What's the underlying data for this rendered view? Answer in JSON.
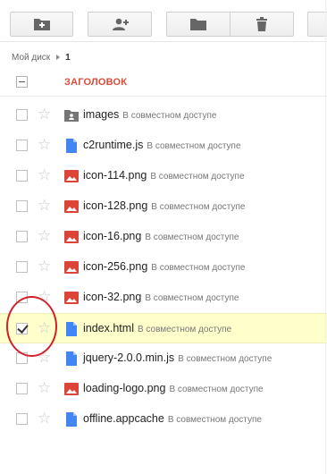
{
  "toolbar": {
    "buttons": [
      {
        "name": "new-folder-icon"
      },
      {
        "name": "share-user-icon"
      },
      {
        "name": "move-folder-icon"
      },
      {
        "name": "delete-icon"
      },
      {
        "name": "more-button"
      }
    ]
  },
  "breadcrumb": {
    "root": "Мой диск",
    "current": "1"
  },
  "header": {
    "title": "ЗАГОЛОВОК"
  },
  "shared_label": "В совместном доступе",
  "files": [
    {
      "name": "images",
      "type": "folder-shared",
      "shared": "В совместном доступе",
      "selected": false
    },
    {
      "name": "c2runtime.js",
      "type": "doc",
      "shared": "В совместном доступе",
      "selected": false
    },
    {
      "name": "icon-114.png",
      "type": "image",
      "shared": "В совместном доступе",
      "selected": false
    },
    {
      "name": "icon-128.png",
      "type": "image",
      "shared": "В совместном доступе",
      "selected": false
    },
    {
      "name": "icon-16.png",
      "type": "image",
      "shared": "В совместном доступе",
      "selected": false
    },
    {
      "name": "icon-256.png",
      "type": "image",
      "shared": "В совместном доступе",
      "selected": false
    },
    {
      "name": "icon-32.png",
      "type": "image",
      "shared": "В совместном доступе",
      "selected": false
    },
    {
      "name": "index.html",
      "type": "doc",
      "shared": "В совместном доступе",
      "selected": true
    },
    {
      "name": "jquery-2.0.0.min.js",
      "type": "doc",
      "shared": "В совместном доступе",
      "selected": false
    },
    {
      "name": "loading-logo.png",
      "type": "image",
      "shared": "В совместном доступе",
      "selected": false
    },
    {
      "name": "offline.appcache",
      "type": "doc",
      "shared": "В совместном доступе",
      "selected": false
    }
  ],
  "colors": {
    "accent_red": "#dd4b39",
    "doc_blue": "#4285f4",
    "image_red": "#db4437",
    "selected_bg": "#ffffcc",
    "annotation": "#d0202a"
  }
}
